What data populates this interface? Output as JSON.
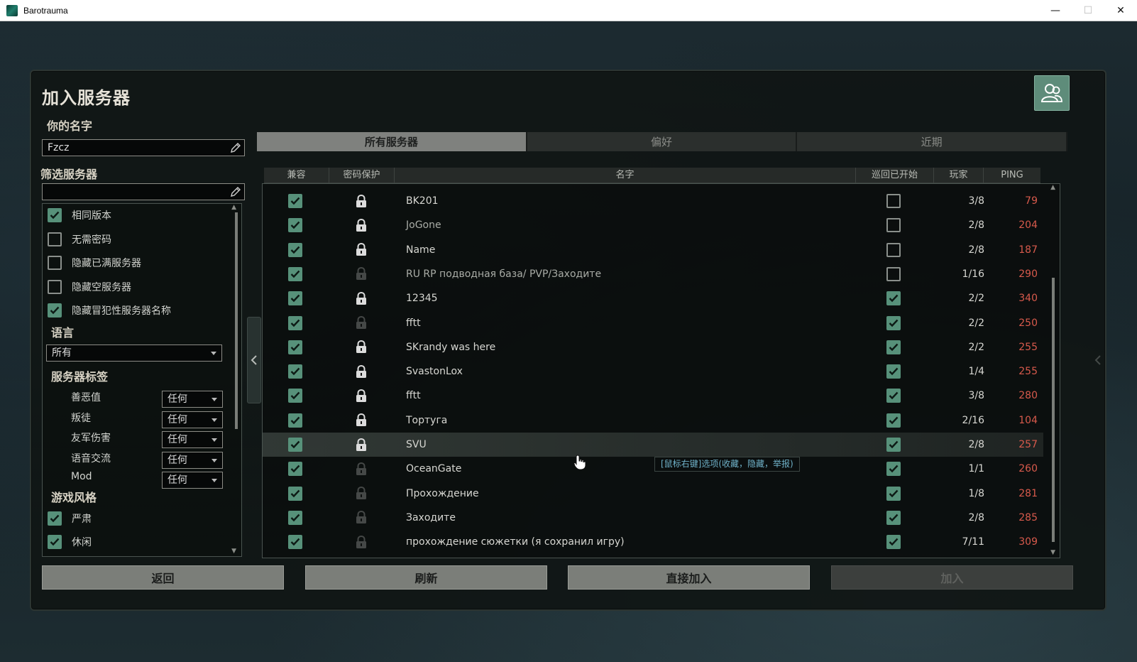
{
  "window": {
    "title": "Barotrauma",
    "minimize": "—",
    "maximize": "☐",
    "close": "✕"
  },
  "panel": {
    "title": "加入服务器",
    "your_name_label": "你的名字",
    "your_name_value": "Fzcz",
    "filter_label": "筛选服务器",
    "filter_value": ""
  },
  "filters": {
    "checkboxes": [
      {
        "label": "相同版本",
        "checked": true
      },
      {
        "label": "无需密码",
        "checked": false
      },
      {
        "label": "隐藏已满服务器",
        "checked": false
      },
      {
        "label": "隐藏空服务器",
        "checked": false
      },
      {
        "label": "隐藏冒犯性服务器名称",
        "checked": true
      }
    ],
    "language_label": "语言",
    "language_value": "所有",
    "tags_label": "服务器标签",
    "tags": [
      {
        "label": "善恶值",
        "value": "任何"
      },
      {
        "label": "叛徒",
        "value": "任何"
      },
      {
        "label": "友军伤害",
        "value": "任何"
      },
      {
        "label": "语音交流",
        "value": "任何"
      },
      {
        "label": "Mod",
        "value": "任何"
      }
    ],
    "playstyle_label": "游戏风格",
    "playstyles": [
      {
        "label": "严肃",
        "checked": true
      },
      {
        "label": "休闲",
        "checked": true
      }
    ]
  },
  "tabs": [
    {
      "label": "所有服务器",
      "active": true
    },
    {
      "label": "偏好",
      "active": false
    },
    {
      "label": "近期",
      "active": false
    }
  ],
  "columns": {
    "compatible": "兼容",
    "password": "密码保护",
    "name": "名字",
    "round_started": "巡回已开始",
    "players": "玩家",
    "ping": "PING"
  },
  "servers": [
    {
      "name": "BK201",
      "compatible": true,
      "locked": true,
      "started": false,
      "players": "3/8",
      "ping": "79",
      "dim": false
    },
    {
      "name": "JoGone",
      "compatible": true,
      "locked": true,
      "started": false,
      "players": "2/8",
      "ping": "204",
      "dim": true
    },
    {
      "name": "Name",
      "compatible": true,
      "locked": true,
      "started": false,
      "players": "2/8",
      "ping": "187",
      "dim": false
    },
    {
      "name": "RU RP подводная база/ PVP/Заходите",
      "compatible": true,
      "locked": false,
      "started": false,
      "players": "1/16",
      "ping": "290",
      "dim": true
    },
    {
      "name": "12345",
      "compatible": true,
      "locked": true,
      "started": true,
      "players": "2/2",
      "ping": "340",
      "dim": false
    },
    {
      "name": "fftt",
      "compatible": true,
      "locked": false,
      "started": true,
      "players": "2/2",
      "ping": "250",
      "dim": false
    },
    {
      "name": "SKrandy was here",
      "compatible": true,
      "locked": true,
      "started": true,
      "players": "2/2",
      "ping": "255",
      "dim": false
    },
    {
      "name": "SvastonLox",
      "compatible": true,
      "locked": true,
      "started": true,
      "players": "1/4",
      "ping": "255",
      "dim": false
    },
    {
      "name": "fftt",
      "compatible": true,
      "locked": true,
      "started": true,
      "players": "3/8",
      "ping": "280",
      "dim": false
    },
    {
      "name": "Тортуга",
      "compatible": true,
      "locked": true,
      "started": true,
      "players": "2/16",
      "ping": "104",
      "dim": false
    },
    {
      "name": "SVU",
      "compatible": true,
      "locked": true,
      "started": true,
      "players": "2/8",
      "ping": "257",
      "dim": false,
      "selected": true
    },
    {
      "name": "OceanGate",
      "compatible": true,
      "locked": false,
      "started": true,
      "players": "1/1",
      "ping": "260",
      "dim": false
    },
    {
      "name": "Прохождение",
      "compatible": true,
      "locked": false,
      "started": true,
      "players": "1/8",
      "ping": "281",
      "dim": false
    },
    {
      "name": "Заходите",
      "compatible": true,
      "locked": false,
      "started": true,
      "players": "2/8",
      "ping": "285",
      "dim": false
    },
    {
      "name": "прохождение сюжетки  (я сохранил игру)",
      "compatible": true,
      "locked": false,
      "started": true,
      "players": "7/11",
      "ping": "309",
      "dim": false
    }
  ],
  "tooltip": "[鼠标右键]选项(收藏，隐藏，举报)",
  "buttons": {
    "back": "返回",
    "refresh": "刷新",
    "direct_join": "直接加入",
    "join": "加入"
  },
  "colors": {
    "accent_green": "#57917a",
    "ping_red": "#d85a4c",
    "tooltip_blue": "#6fb1c8"
  }
}
